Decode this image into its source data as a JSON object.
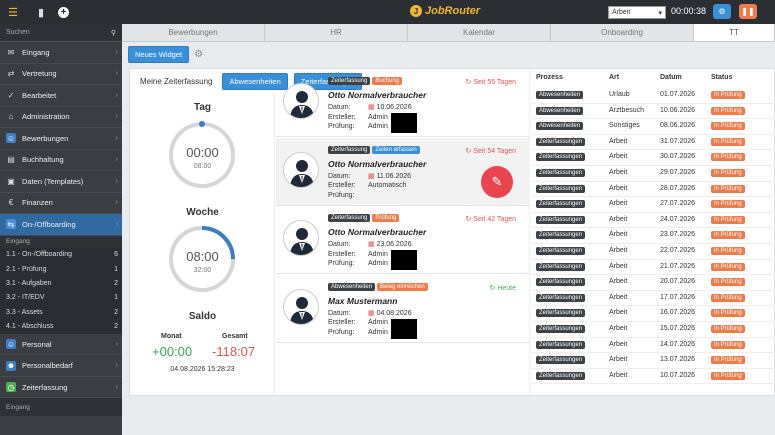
{
  "topbar": {
    "logo_text": "JobRouter",
    "select_value": "Arbeit",
    "timer": "00:00:38",
    "icons": [
      "menu-icon",
      "bookmark-icon",
      "add-icon",
      "gear-icon",
      "pause-icon"
    ],
    "colors": {
      "bg": "#2b2f33",
      "logo": "#f2b632",
      "settings_btn": "#3a8fd9",
      "pause_btn": "#f07b4a"
    }
  },
  "sidebar": {
    "search_placeholder": "Suchen",
    "items": [
      {
        "label": "Eingang",
        "icon": "inbox-icon"
      },
      {
        "label": "Vertretung",
        "icon": "deputy-icon"
      },
      {
        "label": "Bearbeitet",
        "icon": "check-icon"
      },
      {
        "label": "Administration",
        "icon": "admin-icon"
      },
      {
        "label": "Bewerbungen",
        "icon": "applications-icon",
        "style": "blue"
      },
      {
        "label": "Buchhaltung",
        "icon": "accounting-icon"
      },
      {
        "label": "Daten (Templates)",
        "icon": "folder-icon"
      },
      {
        "label": "Finanzen",
        "icon": "euro-icon"
      },
      {
        "label": "On-/Offboarding",
        "icon": "onboarding-icon",
        "style": "active"
      }
    ],
    "group1": "Eingang",
    "sub_items": [
      {
        "label": "1.1 - On-/Offboarding",
        "count": "6"
      },
      {
        "label": "2.1 - Prüfung",
        "count": "1"
      },
      {
        "label": "3.1 - Aufgaben",
        "count": "2"
      },
      {
        "label": "3.2 - IT/EDV",
        "count": "1"
      },
      {
        "label": "3.3 - Assets",
        "count": "2"
      },
      {
        "label": "4.1 - Abschluss",
        "count": "2"
      }
    ],
    "items2": [
      {
        "label": "Personal",
        "icon": "person-icon",
        "style": "blue"
      },
      {
        "label": "Personalbedarf",
        "icon": "people-icon",
        "style": "blue"
      },
      {
        "label": "Zeiterfassung",
        "icon": "time-icon",
        "style": "green"
      }
    ],
    "group2": "Eingang"
  },
  "tabs": [
    "Bewerbungen",
    "HR",
    "Kalendar",
    "Onboarding",
    "TT"
  ],
  "toolbar": {
    "new_widget": "Neues Widget"
  },
  "widget": {
    "title": "Meine Zeiterfassung",
    "btn_absences": "Abwesenheiten",
    "btn_times": "Zeiterfassungen",
    "day": {
      "title": "Tag",
      "value": "00:00",
      "target": "08:00",
      "progress": 0.0
    },
    "week": {
      "title": "Woche",
      "value": "08:00",
      "target": "32:00",
      "progress": 0.25
    },
    "saldo": {
      "title": "Saldo",
      "month_label": "Monat",
      "month_value": "+00:00",
      "total_label": "Gesamt",
      "total_value": "-118:07",
      "timestamp": "04.08.2026 15:28:23"
    }
  },
  "cards": [
    {
      "badges": [
        {
          "t": "Zeiterfassung",
          "c": "dark"
        },
        {
          "t": "Buchung",
          "c": "orange"
        }
      ],
      "since": "Seit 55 Tagen",
      "since_color": "#e05353",
      "since_icon": "history-icon",
      "name": "Otto Normalverbraucher",
      "date": "10.06.2026",
      "creator": "Admin",
      "reviewer": "Admin",
      "redacted": true
    },
    {
      "badges": [
        {
          "t": "Zeiterfassung",
          "c": "dark"
        },
        {
          "t": "Zeiten erfassen",
          "c": "blue"
        }
      ],
      "since": "Seit 54 Tagen",
      "since_color": "#e05353",
      "since_icon": "history-icon",
      "name": "Otto Normalverbraucher",
      "date": "11.06.2026",
      "creator": "Automatisch",
      "reviewer": "",
      "redacted": false,
      "selected": true
    },
    {
      "badges": [
        {
          "t": "Zeiterfassung",
          "c": "dark"
        },
        {
          "t": "Prüfung",
          "c": "orange"
        }
      ],
      "since": "Seit 42 Tagen",
      "since_color": "#e05353",
      "since_icon": "history-icon",
      "name": "Otto Normalverbraucher",
      "date": "23.06.2026",
      "creator": "Admin",
      "reviewer": "Admin",
      "redacted": true
    },
    {
      "badges": [
        {
          "t": "Abwesenheiten",
          "c": "dark"
        },
        {
          "t": "Beleg einreichen",
          "c": "orange"
        }
      ],
      "since": "Heute",
      "since_color": "#4caf50",
      "since_icon": "history-icon",
      "name": "Max Mustermann",
      "date": "04.08.2026",
      "creator": "Admin",
      "reviewer": "Admin",
      "redacted": true
    }
  ],
  "card_labels": {
    "date": "Datum:",
    "creator": "Ersteller:",
    "reviewer": "Prüfung:"
  },
  "table": {
    "headers": [
      "Prozess",
      "Art",
      "Datum",
      "Status"
    ],
    "rows": [
      [
        "Abwesenheiten",
        "Urlaub",
        "01.07.2026",
        "In Prüfung"
      ],
      [
        "Abwesenheiten",
        "Arztbesuch",
        "10.06.2026",
        "In Prüfung"
      ],
      [
        "Abwesenheiten",
        "Sonstiges",
        "08.06.2026",
        "In Prüfung"
      ],
      [
        "Zeiterfassungen",
        "Arbeit",
        "31.07.2026",
        "In Prüfung"
      ],
      [
        "Zeiterfassungen",
        "Arbeit",
        "30.07.2026",
        "In Prüfung"
      ],
      [
        "Zeiterfassungen",
        "Arbeit",
        "29.07.2026",
        "In Prüfung"
      ],
      [
        "Zeiterfassungen",
        "Arbeit",
        "28.07.2026",
        "In Prüfung"
      ],
      [
        "Zeiterfassungen",
        "Arbeit",
        "27.07.2026",
        "In Prüfung"
      ],
      [
        "Zeiterfassungen",
        "Arbeit",
        "24.07.2026",
        "In Prüfung"
      ],
      [
        "Zeiterfassungen",
        "Arbeit",
        "23.07.2026",
        "In Prüfung"
      ],
      [
        "Zeiterfassungen",
        "Arbeit",
        "22.07.2026",
        "In Prüfung"
      ],
      [
        "Zeiterfassungen",
        "Arbeit",
        "21.07.2026",
        "In Prüfung"
      ],
      [
        "Zeiterfassungen",
        "Arbeit",
        "20.07.2026",
        "In Prüfung"
      ],
      [
        "Zeiterfassungen",
        "Arbeit",
        "17.07.2026",
        "In Prüfung"
      ],
      [
        "Zeiterfassungen",
        "Arbeit",
        "16.07.2026",
        "In Prüfung"
      ],
      [
        "Zeiterfassungen",
        "Arbeit",
        "15.07.2026",
        "In Prüfung"
      ],
      [
        "Zeiterfassungen",
        "Arbeit",
        "14.07.2026",
        "In Prüfung"
      ],
      [
        "Zeiterfassungen",
        "Arbeit",
        "13.07.2026",
        "In Prüfung"
      ],
      [
        "Zeiterfassungen",
        "Arbeit",
        "10.07.2026",
        "In Prüfung"
      ]
    ]
  }
}
